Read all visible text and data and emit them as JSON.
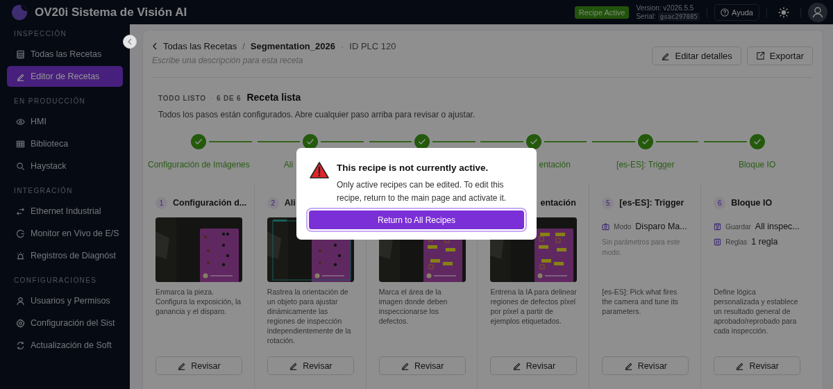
{
  "app": {
    "title": "OV20i Sistema de Visión AI",
    "status_badge": "Recipe Active",
    "version": "Version: v2026.5.5",
    "serial_label": "Serial:",
    "serial": "gsac297085",
    "help": "Ayuda"
  },
  "sidebar": {
    "sections": [
      {
        "title": "INSPECCIÓN",
        "items": [
          {
            "label": "Todas las Recetas",
            "selected": false
          },
          {
            "label": "Editor de Recetas",
            "selected": true
          }
        ]
      },
      {
        "title": "EN PRODUCCIÓN",
        "items": [
          {
            "label": "HMI",
            "selected": false
          },
          {
            "label": "Biblioteca",
            "selected": false
          },
          {
            "label": "Haystack",
            "selected": false
          }
        ]
      },
      {
        "title": "INTEGRACIÓN",
        "items": [
          {
            "label": "Ethernet Industrial",
            "selected": false
          },
          {
            "label": "Monitor en Vivo de E/S",
            "selected": false
          },
          {
            "label": "Registros de Diagnóst",
            "selected": false
          }
        ]
      },
      {
        "title": "CONFIGURACIONES",
        "items": [
          {
            "label": "Usuarios y Permisos",
            "selected": false
          },
          {
            "label": "Configuración del Sist",
            "selected": false
          },
          {
            "label": "Actualización de Soft",
            "selected": false
          }
        ]
      }
    ]
  },
  "recipe": {
    "breadcrumb_back": "Todas las Recetas",
    "separator": "/",
    "name": "Segmentation_2026",
    "dot": "·",
    "plc_id": "ID PLC 120",
    "description_placeholder": "Escribe una descripción para esta receta",
    "buttons": [
      "Editar detalles",
      "Exportar"
    ]
  },
  "progress": {
    "status": "TODO LISTO",
    "dot": "·",
    "count": "6 DE 6",
    "title": "Receta lista",
    "text": "Todos los pasos están configurados. Abre cualquier paso arriba para revisar o ajustar."
  },
  "steps": [
    {
      "label": "Configuración de Imágenes",
      "done": true
    },
    {
      "label": "Ali",
      "done": true
    },
    {
      "done": true
    },
    {
      "label": "entación",
      "done": true
    },
    {
      "label": "[es-ES]: Trigger",
      "done": true
    },
    {
      "label": "Bloque IO",
      "done": true
    }
  ],
  "cards": [
    {
      "num": "1",
      "title": "Configuración d...",
      "kind": "picture",
      "description": "Enmarca la pieza. Configura la exposición, la ganancia y el disparo.",
      "button": "Revisar"
    },
    {
      "num": "2",
      "title": "Ali",
      "kind": "picture",
      "description": "Rastrea la orientación de un objeto para ajustar dinámicamente las regiones de inspección independientemente de la rotación.",
      "button": "Revisar"
    },
    {
      "kind": "picture",
      "description": "Marca el área de la imagen donde deben inspeccionarse los defectos.",
      "button": "Revisar"
    },
    {
      "title": "entación",
      "kind": "picture",
      "description": "Entrena la IA para delinear regiones de defectos píxel por píxel a partir de ejemplos etiquetados.",
      "button": "Revisar"
    },
    {
      "num": "5",
      "title": "[es-ES]: Trigger",
      "kind": "fields",
      "fields": [
        {
          "label": "Modo",
          "value": "Disparo Ma..."
        }
      ],
      "note": "Sin parámetros para este modo.",
      "description": "[es-ES]: Pick what fires the camera and tune its parameters.",
      "button": "Revisar"
    },
    {
      "num": "6",
      "title": "Bloque IO",
      "kind": "fields",
      "fields": [
        {
          "label": "Guardar",
          "value": "All inspec..."
        },
        {
          "label": "Reglas",
          "value": "1 regla"
        }
      ],
      "description": "Define lógica personalizada y establece un resultado general de aprobado/reprobado para cada inspección.",
      "button": "Revisar"
    }
  ],
  "modal": {
    "title": "This recipe is not currently active.",
    "body": "Only active recipes can be edited. To edit this recipe, return to the main page and activate it.",
    "button": "Return to All Recipes"
  }
}
